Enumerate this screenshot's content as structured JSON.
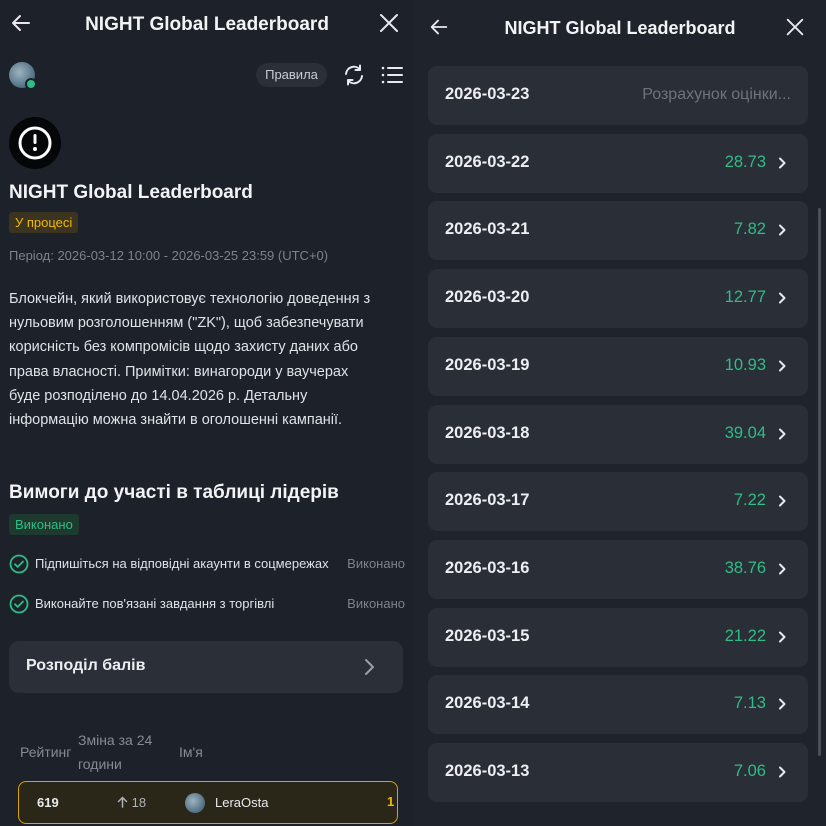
{
  "left": {
    "header": {
      "title": "NIGHT Global Leaderboard"
    },
    "rules_label": "Правила",
    "title": "NIGHT Global Leaderboard",
    "status": "У процесі",
    "period": "Період: 2026-03-12 10:00 - 2026-03-25 23:59 (UTC+0)",
    "description": [
      "Блокчейн, який використовує технологію доведення з",
      "нульовим розголошенням (\"ZK\"), щоб забезпечувати",
      "корисність без компромісів щодо захисту даних або",
      "права власності. Примітки: винагороди у ваучерах",
      "буде розподілено до 14.04.2026 р. Детальну",
      "інформацію можна знайти в оголошенні кампанії."
    ],
    "requirements": {
      "title": "Вимоги до участі в таблиці лідерів",
      "status": "Виконано",
      "items": [
        {
          "text": "Підпишіться на відповідні акаунти в соцмережах",
          "status": "Виконано"
        },
        {
          "text": "Виконайте пов'язані завдання з торгівлі",
          "status": "Виконано"
        }
      ]
    },
    "distribution_label": "Розподіл балів",
    "table": {
      "col_rank": "Рейтинг",
      "col_change_1": "Зміна за 24",
      "col_change_2": "години",
      "col_name": "Ім'я"
    },
    "my_row": {
      "rank": "619",
      "change": "18",
      "name": "LeraOsta",
      "points": "1"
    }
  },
  "right": {
    "header": {
      "title": "NIGHT Global Leaderboard"
    },
    "pending_label": "Розрахунок оцінки...",
    "days": [
      {
        "date": "2026-03-23",
        "score": null
      },
      {
        "date": "2026-03-22",
        "score": "28.73"
      },
      {
        "date": "2026-03-21",
        "score": "7.82"
      },
      {
        "date": "2026-03-20",
        "score": "12.77"
      },
      {
        "date": "2026-03-19",
        "score": "10.93"
      },
      {
        "date": "2026-03-18",
        "score": "39.04"
      },
      {
        "date": "2026-03-17",
        "score": "7.22"
      },
      {
        "date": "2026-03-16",
        "score": "38.76"
      },
      {
        "date": "2026-03-15",
        "score": "21.22"
      },
      {
        "date": "2026-03-14",
        "score": "7.13"
      },
      {
        "date": "2026-03-13",
        "score": "7.06"
      }
    ]
  },
  "colors": {
    "accent_green": "#2ebd85",
    "accent_yellow": "#f0b90b",
    "card_bg": "#2a2e37"
  }
}
